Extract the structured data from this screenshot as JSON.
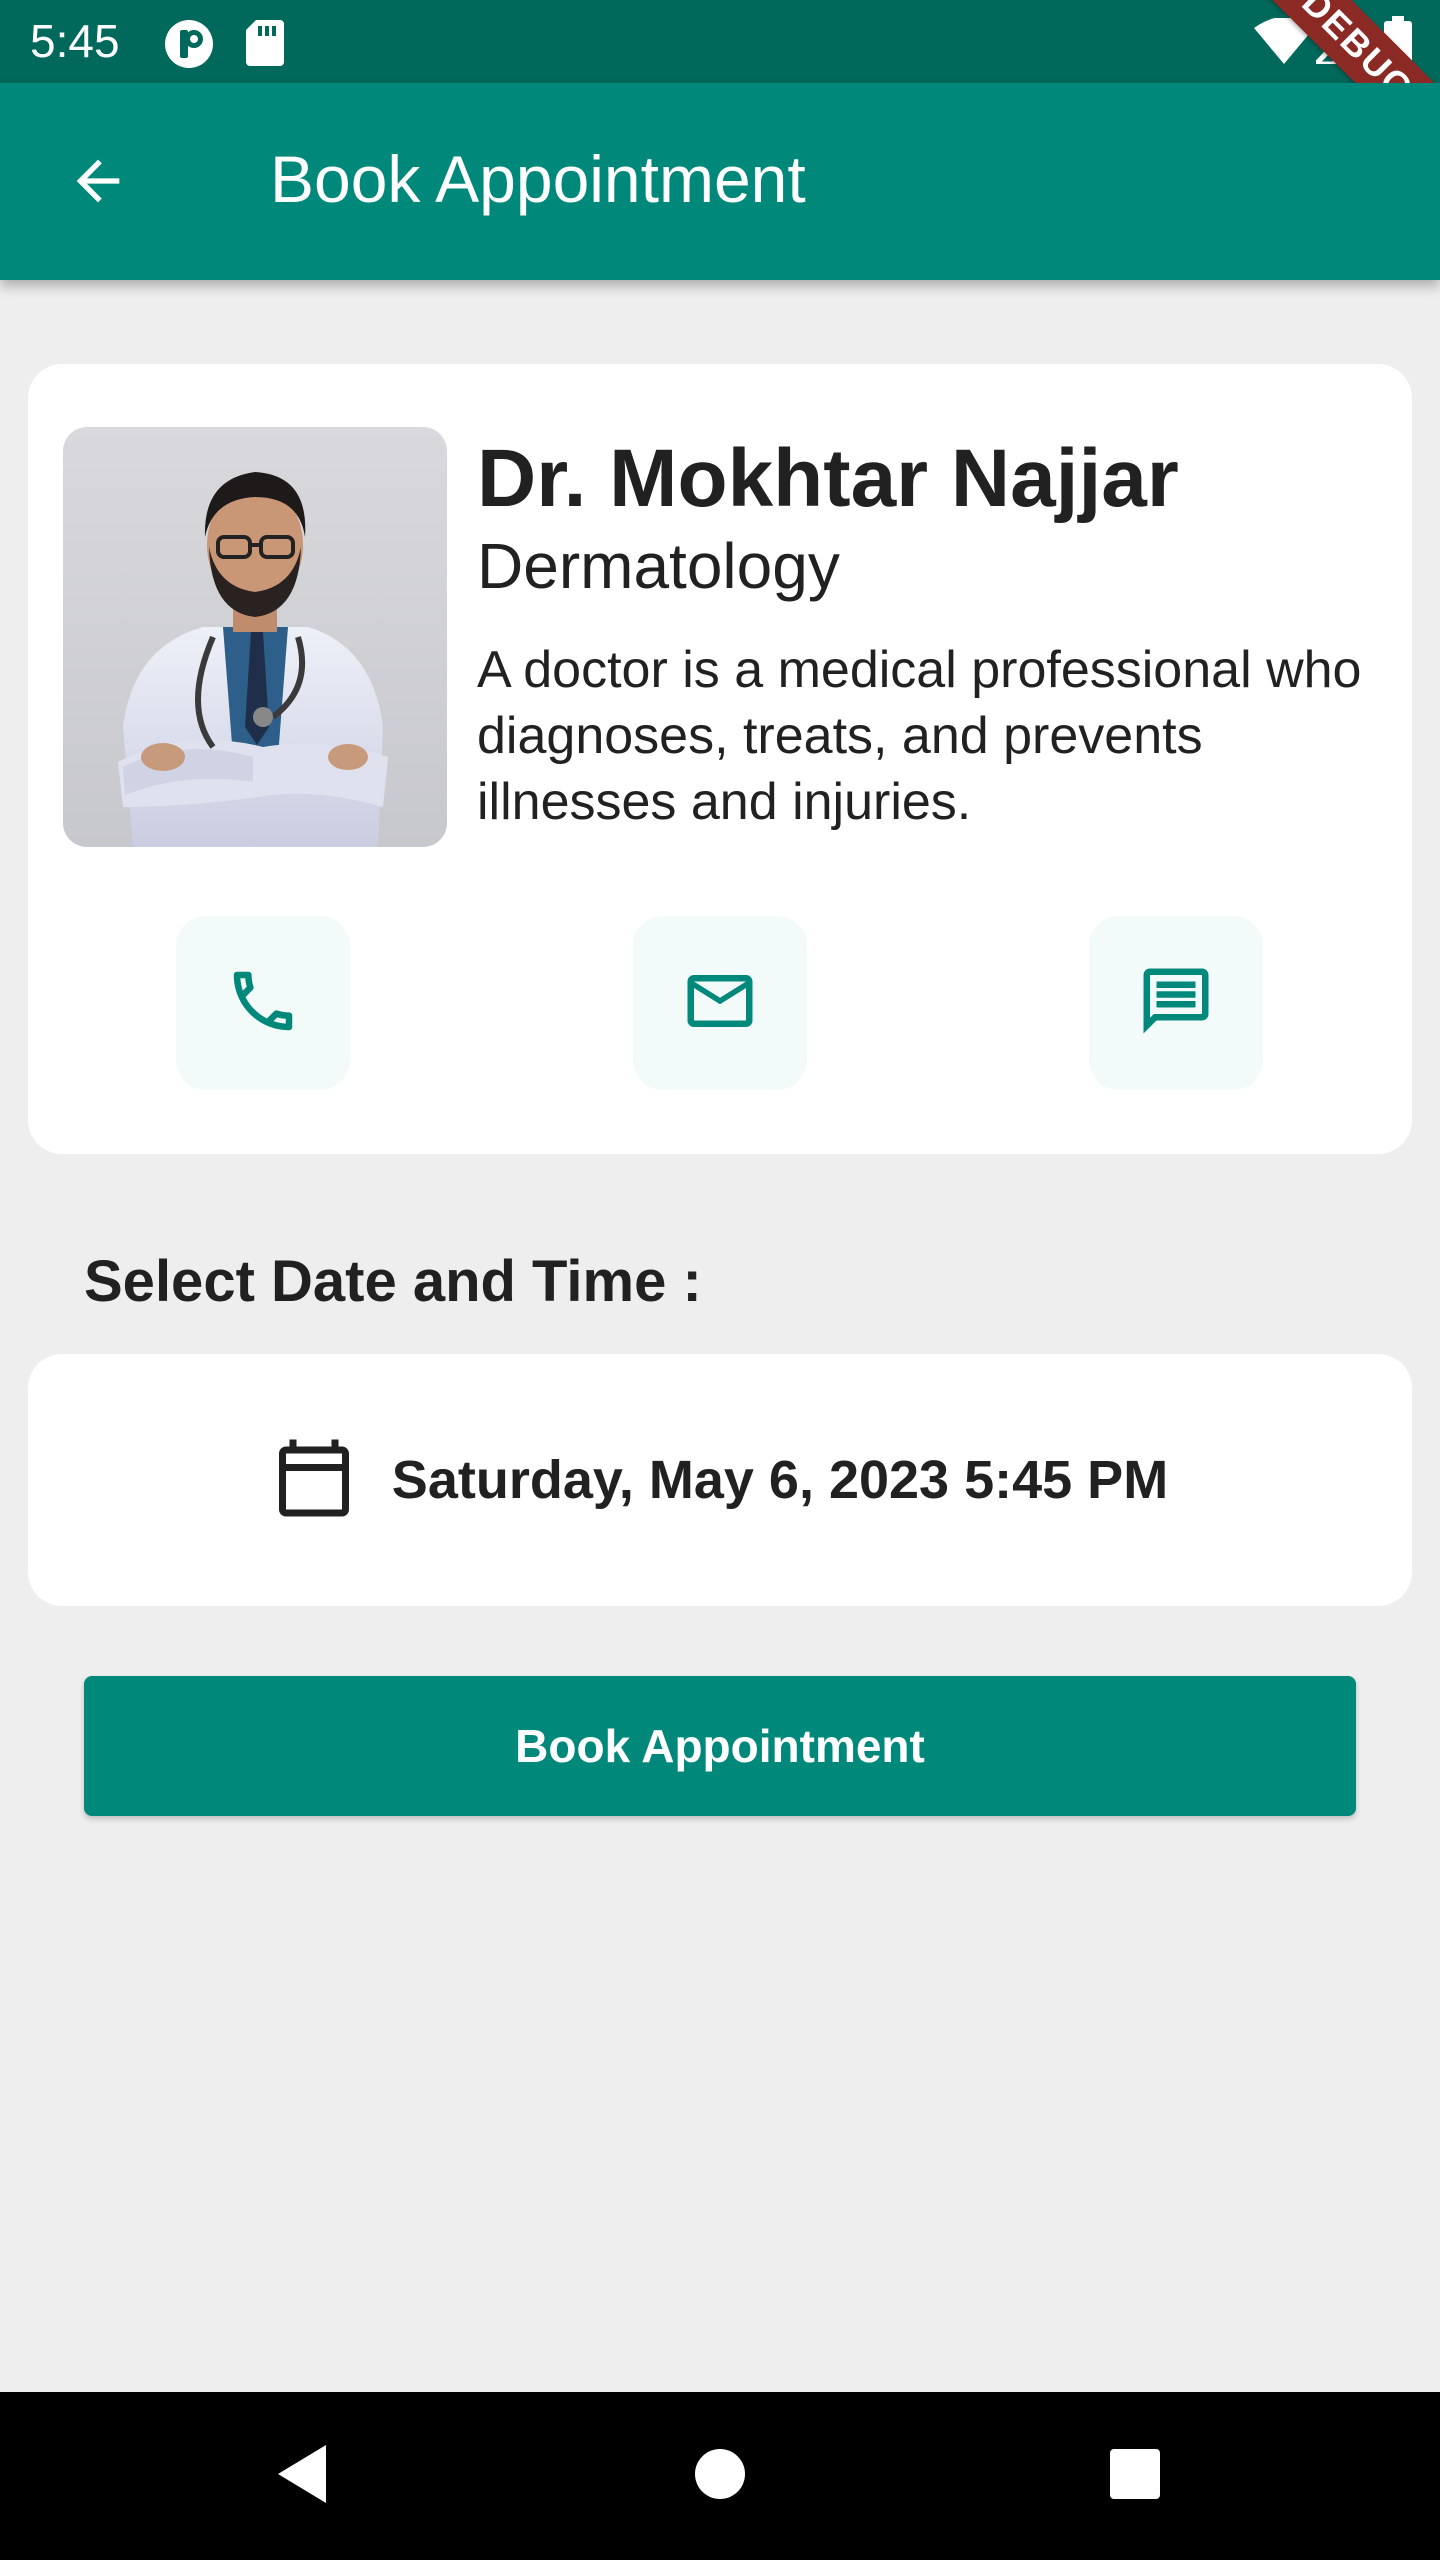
{
  "status_bar": {
    "time": "5:45",
    "icons": [
      "notification-p-icon",
      "sd-card-icon",
      "wifi-icon",
      "signal-icon",
      "battery-icon"
    ]
  },
  "app_bar": {
    "title": "Book Appointment",
    "back_icon": "arrow-left-icon",
    "debug_banner": "DEBUG"
  },
  "doctor": {
    "name": "Dr. Mokhtar Najjar",
    "specialty": "Dermatology",
    "description": "A doctor is a medical professional who diagnoses, treats, and prevents illnesses and injuries.",
    "actions": [
      {
        "icon": "phone-icon"
      },
      {
        "icon": "mail-icon"
      },
      {
        "icon": "message-icon"
      }
    ]
  },
  "schedule": {
    "section_title": "Select Date and Time :",
    "selected_datetime": "Saturday, May 6, 2023 5:45 PM",
    "calendar_icon": "calendar-icon"
  },
  "book_button": {
    "label": "Book Appointment"
  },
  "colors": {
    "primary": "#00897b",
    "primary_dark": "#00695b",
    "background": "#eeeeee",
    "card": "#ffffff",
    "action_bg": "#f3fbfa",
    "debug": "#8b2a24"
  },
  "nav_bar": {
    "icons": [
      "back-triangle-icon",
      "home-circle-icon",
      "recents-square-icon"
    ]
  }
}
